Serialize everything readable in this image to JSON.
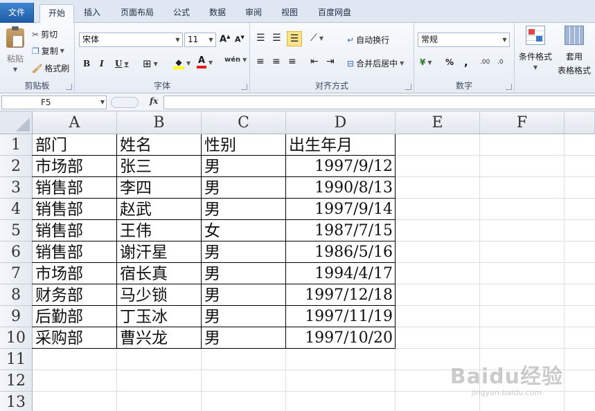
{
  "tabs": [
    "文件",
    "开始",
    "插入",
    "页面布局",
    "公式",
    "数据",
    "审阅",
    "视图",
    "百度网盘"
  ],
  "active_tab": "开始",
  "clipboard": {
    "paste": "粘贴",
    "cut": "剪切",
    "copy": "复制",
    "format_painter": "格式刷",
    "label": "剪贴板"
  },
  "font": {
    "name": "宋体",
    "size": "11",
    "bold": "B",
    "italic": "I",
    "underline": "U",
    "label": "字体",
    "phonetic": "wén"
  },
  "alignment": {
    "wrap_text": "自动换行",
    "merge_center": "合并后居中",
    "label": "对齐方式"
  },
  "number": {
    "format": "常规",
    "percent": "%",
    "comma": ",",
    "label": "数字",
    "inc_decimal": ".00",
    "dec_decimal": ".0"
  },
  "styles": {
    "conditional": "条件格式",
    "table_format_1": "套用",
    "table_format_2": "表格格式"
  },
  "formula_bar": {
    "name_box": "F5",
    "fx": "fx",
    "content": ""
  },
  "columns": [
    "A",
    "B",
    "C",
    "D",
    "E",
    "F"
  ],
  "rows": [
    "1",
    "2",
    "3",
    "4",
    "5",
    "6",
    "7",
    "8",
    "9",
    "10",
    "11",
    "12",
    "13"
  ],
  "table": {
    "headers": [
      "部门",
      "姓名",
      "性别",
      "出生年月"
    ],
    "rows": [
      [
        "市场部",
        "张三",
        "男",
        "1997/9/12"
      ],
      [
        "销售部",
        "李四",
        "男",
        "1990/8/13"
      ],
      [
        "销售部",
        "赵武",
        "男",
        "1997/9/14"
      ],
      [
        "销售部",
        "王伟",
        "女",
        "1987/7/15"
      ],
      [
        "销售部",
        "谢汗星",
        "男",
        "1986/5/16"
      ],
      [
        "市场部",
        "宿长真",
        "男",
        "1994/4/17"
      ],
      [
        "财务部",
        "马少锁",
        "男",
        "1997/12/18"
      ],
      [
        "后勤部",
        "丁玉冰",
        "男",
        "1997/11/19"
      ],
      [
        "采购部",
        "曹兴龙",
        "男",
        "1997/10/20"
      ]
    ]
  },
  "watermark": {
    "brand": "Baidu经验",
    "url": "jingyan.baidu.com"
  },
  "colors": {
    "file_tab": "#2a6bbf",
    "ribbon_bg": "#e6ecf4",
    "grid_line": "#dadfe6",
    "header_bg": "#e4e9f1"
  }
}
